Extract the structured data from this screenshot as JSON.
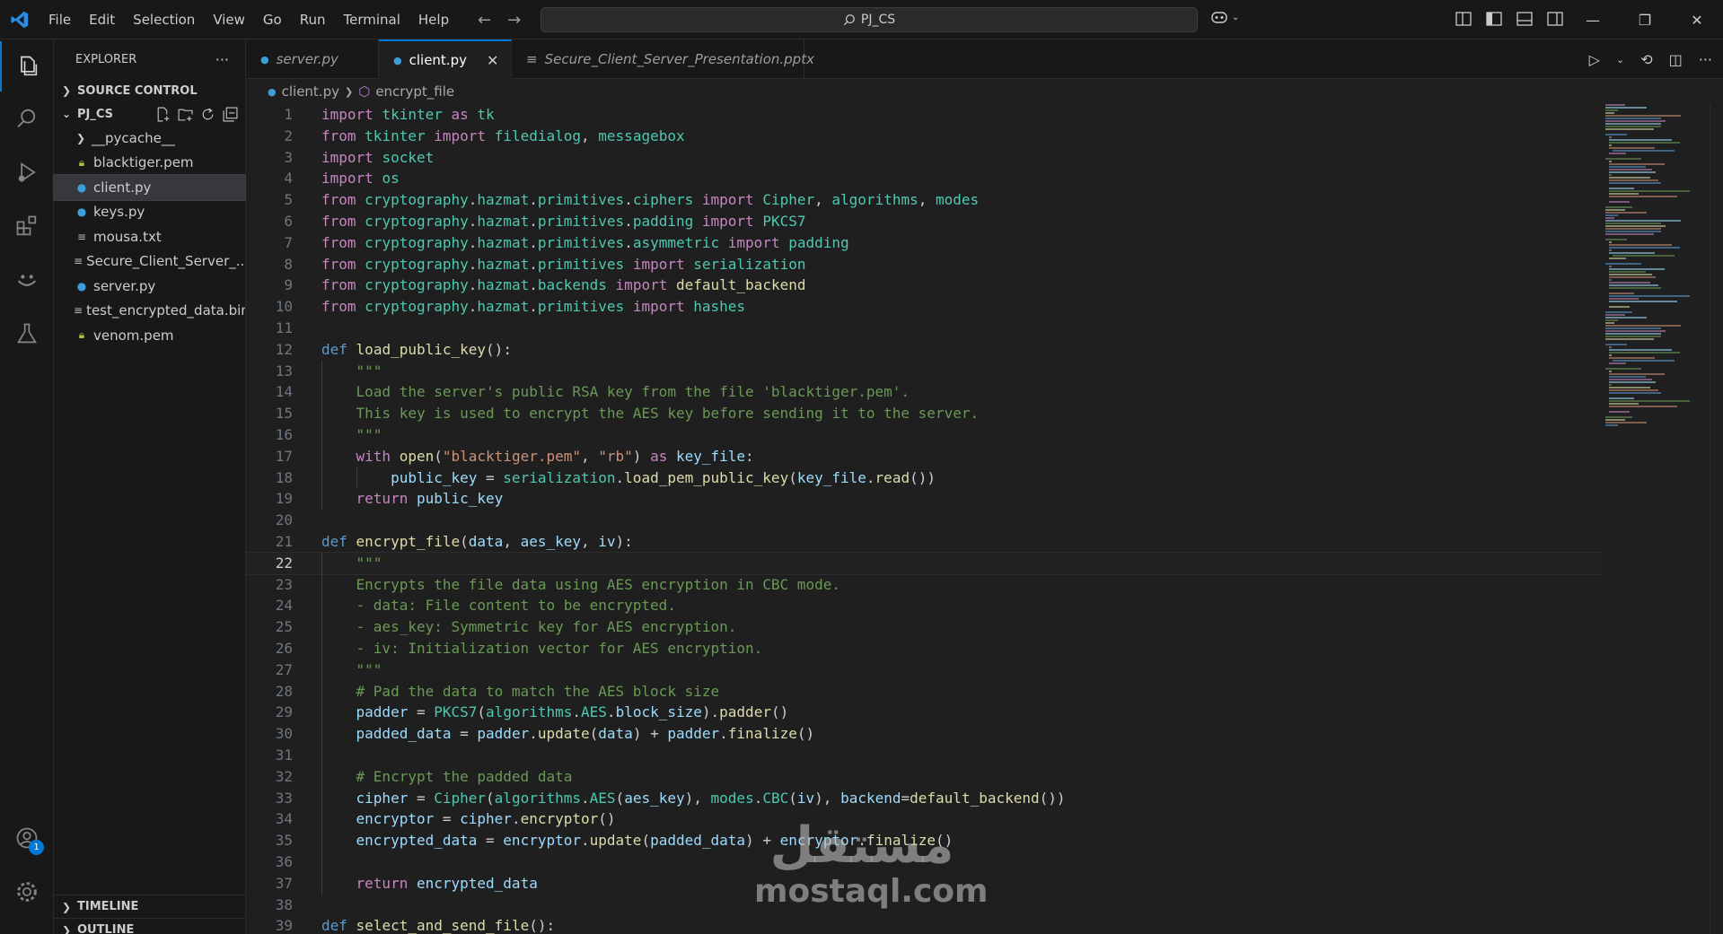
{
  "menu": [
    "File",
    "Edit",
    "Selection",
    "View",
    "Go",
    "Run",
    "Terminal",
    "Help"
  ],
  "search": {
    "text": "PJ_CS"
  },
  "sidebar": {
    "header": "EXPLORER",
    "source_control": "SOURCE CONTROL",
    "project": "PJ_CS",
    "items": [
      {
        "name": "__pycache__",
        "type": "folder"
      },
      {
        "name": "blacktiger.pem",
        "type": "pem"
      },
      {
        "name": "client.py",
        "type": "py",
        "selected": true
      },
      {
        "name": "keys.py",
        "type": "py"
      },
      {
        "name": "mousa.txt",
        "type": "txt"
      },
      {
        "name": "Secure_Client_Server_...",
        "type": "txt"
      },
      {
        "name": "server.py",
        "type": "py"
      },
      {
        "name": "test_encrypted_data.bin",
        "type": "txt"
      },
      {
        "name": "venom.pem",
        "type": "pem"
      }
    ],
    "timeline": "TIMELINE",
    "outline": "OUTLINE"
  },
  "accounts_badge": "1",
  "tabs": [
    {
      "label": "server.py",
      "active": false
    },
    {
      "label": "client.py",
      "active": true
    },
    {
      "label": "Secure_Client_Server_Presentation.pptx",
      "active": false
    }
  ],
  "breadcrumb": {
    "file": "client.py",
    "symbol": "encrypt_file"
  },
  "editor": {
    "current_line": 22,
    "lines": [
      {
        "n": "1",
        "t": "import tkinter as tk"
      },
      {
        "n": "2",
        "t": "from tkinter import filedialog, messagebox"
      },
      {
        "n": "3",
        "t": "import socket"
      },
      {
        "n": "4",
        "t": "import os"
      },
      {
        "n": "5",
        "t": "from cryptography.hazmat.primitives.ciphers import Cipher, algorithms, modes"
      },
      {
        "n": "6",
        "t": "from cryptography.hazmat.primitives.padding import PKCS7"
      },
      {
        "n": "7",
        "t": "from cryptography.hazmat.primitives.asymmetric import padding"
      },
      {
        "n": "8",
        "t": "from cryptography.hazmat.primitives import serialization"
      },
      {
        "n": "9",
        "t": "from cryptography.hazmat.backends import default_backend"
      },
      {
        "n": "10",
        "t": "from cryptography.hazmat.primitives import hashes"
      },
      {
        "n": "11",
        "t": ""
      },
      {
        "n": "12",
        "t": "def load_public_key():"
      },
      {
        "n": "13",
        "t": "    \"\"\""
      },
      {
        "n": "14",
        "t": "    Load the server's public RSA key from the file 'blacktiger.pem'."
      },
      {
        "n": "15",
        "t": "    This key is used to encrypt the AES key before sending it to the server."
      },
      {
        "n": "16",
        "t": "    \"\"\""
      },
      {
        "n": "17",
        "t": "    with open(\"blacktiger.pem\", \"rb\") as key_file:"
      },
      {
        "n": "18",
        "t": "        public_key = serialization.load_pem_public_key(key_file.read())"
      },
      {
        "n": "19",
        "t": "    return public_key"
      },
      {
        "n": "20",
        "t": ""
      },
      {
        "n": "21",
        "t": "def encrypt_file(data, aes_key, iv):"
      },
      {
        "n": "22",
        "t": "    \"\"\""
      },
      {
        "n": "23",
        "t": "    Encrypts the file data using AES encryption in CBC mode."
      },
      {
        "n": "24",
        "t": "    - data: File content to be encrypted."
      },
      {
        "n": "25",
        "t": "    - aes_key: Symmetric key for AES encryption."
      },
      {
        "n": "26",
        "t": "    - iv: Initialization vector for AES encryption."
      },
      {
        "n": "27",
        "t": "    \"\"\""
      },
      {
        "n": "28",
        "t": "    # Pad the data to match the AES block size"
      },
      {
        "n": "29",
        "t": "    padder = PKCS7(algorithms.AES.block_size).padder()"
      },
      {
        "n": "30",
        "t": "    padded_data = padder.update(data) + padder.finalize()"
      },
      {
        "n": "31",
        "t": ""
      },
      {
        "n": "32",
        "t": "    # Encrypt the padded data"
      },
      {
        "n": "33",
        "t": "    cipher = Cipher(algorithms.AES(aes_key), modes.CBC(iv), backend=default_backend())"
      },
      {
        "n": "34",
        "t": "    encryptor = cipher.encryptor()"
      },
      {
        "n": "35",
        "t": "    encrypted_data = encryptor.update(padded_data) + encryptor.finalize()"
      },
      {
        "n": "36",
        "t": ""
      },
      {
        "n": "37",
        "t": "    return encrypted_data"
      },
      {
        "n": "38",
        "t": ""
      },
      {
        "n": "39",
        "t": "def select_and_send_file():"
      }
    ]
  },
  "watermark": {
    "arabic": "مستقل",
    "latin": "mostaql.com"
  },
  "colors": {
    "accent": "#0078d4",
    "background": "#1f1f1f",
    "sidebar": "#181818"
  }
}
